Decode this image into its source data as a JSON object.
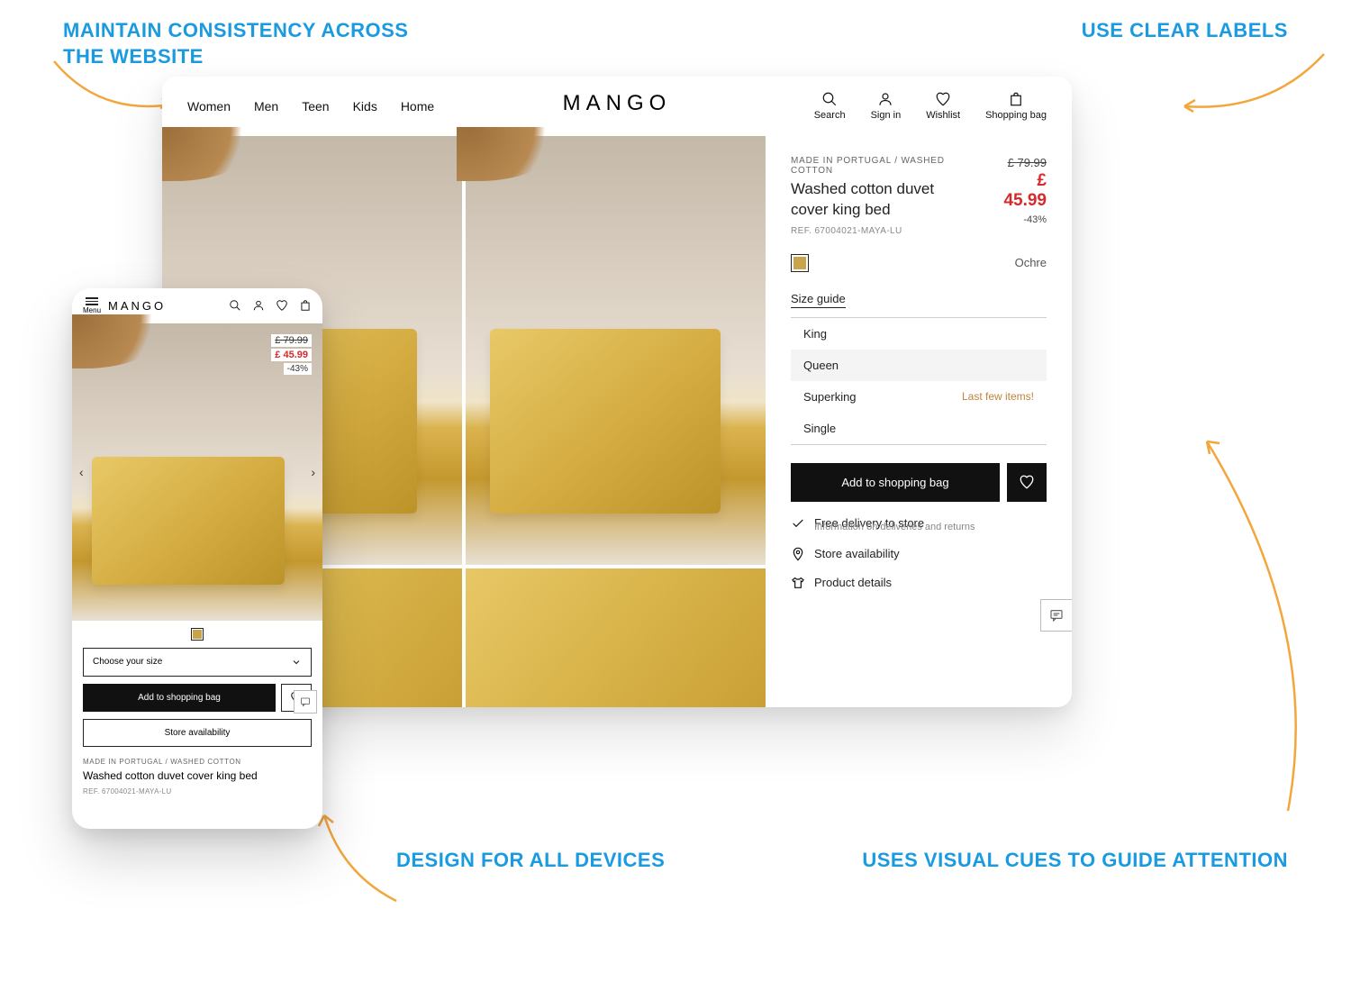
{
  "callouts": {
    "tl": "MAINTAIN CONSISTENCY ACROSS THE WEBSITE",
    "tr": "USE CLEAR LABELS",
    "bl": "DESIGN FOR ALL DEVICES",
    "br": "USES VISUAL CUES TO GUIDE ATTENTION"
  },
  "brand": "MANGO",
  "nav": {
    "items": [
      "Women",
      "Men",
      "Teen",
      "Kids",
      "Home"
    ]
  },
  "actions": {
    "search": "Search",
    "signin": "Sign in",
    "wishlist": "Wishlist",
    "bag": "Shopping bag"
  },
  "product": {
    "tag": "MADE IN PORTUGAL / WASHED COTTON",
    "title": "Washed cotton duvet cover king bed",
    "ref": "REF. 67004021-MAYA-LU",
    "price_old": "£ 79.99",
    "price_new": "£ 45.99",
    "discount": "-43%",
    "color_name": "Ochre",
    "size_guide": "Size guide",
    "sizes": [
      {
        "label": "King",
        "note": ""
      },
      {
        "label": "Queen",
        "note": ""
      },
      {
        "label": "Superking",
        "note": "Last few items!"
      },
      {
        "label": "Single",
        "note": ""
      }
    ],
    "add_label": "Add to shopping bag",
    "free_delivery": "Free delivery to store",
    "delivery_sub": "Information on deliveries and returns",
    "store_avail": "Store availability",
    "details": "Product details"
  },
  "mobile": {
    "menu_label": "Menu",
    "choose_size": "Choose your size",
    "add_label": "Add to shopping bag",
    "store_avail": "Store availability"
  }
}
